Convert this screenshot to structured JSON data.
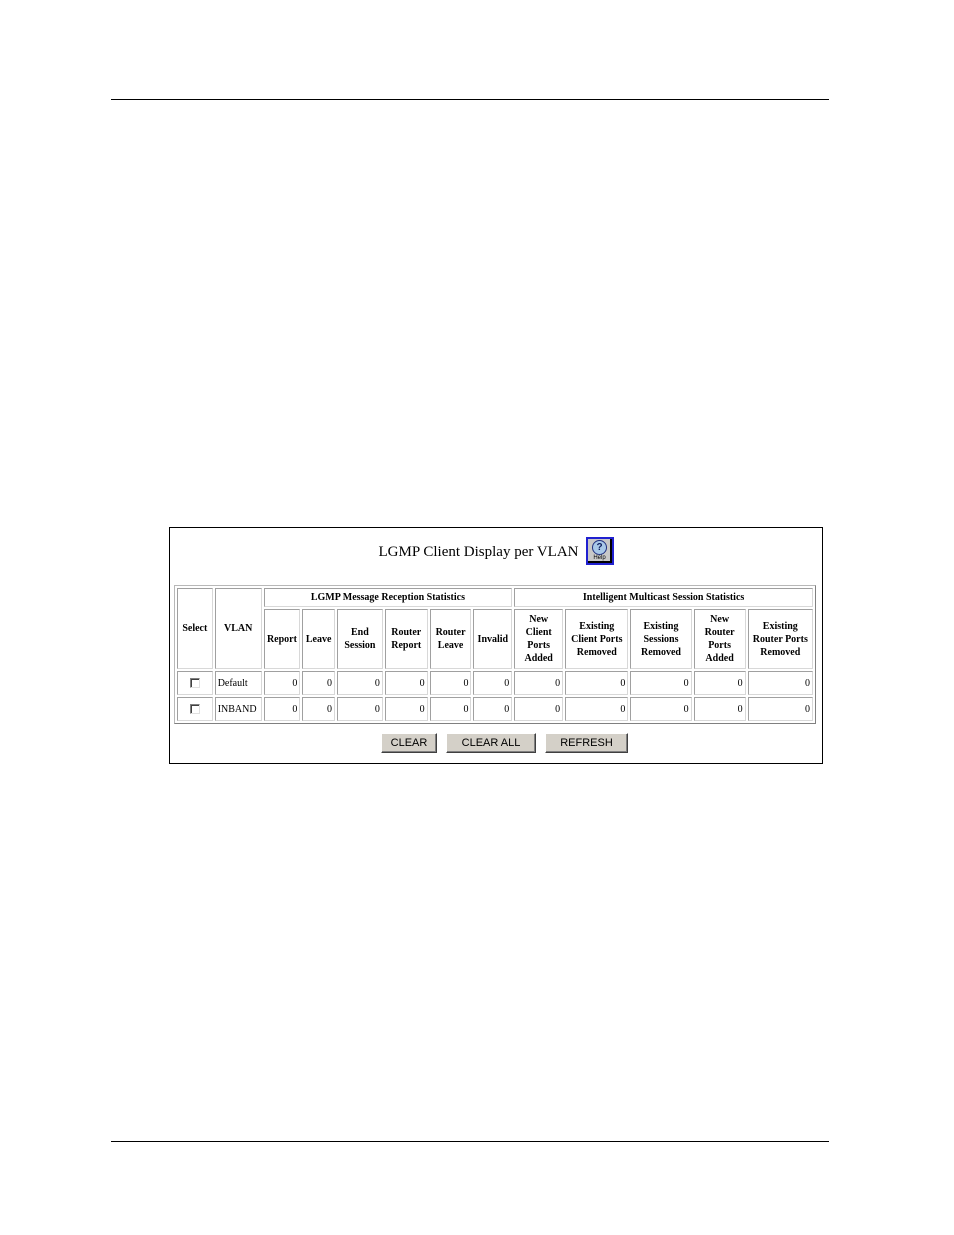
{
  "panel": {
    "title": "LGMP Client Display per VLAN",
    "help_icon_label": "Help",
    "help_icon_glyph": "?"
  },
  "table": {
    "headers": {
      "select": "Select",
      "vlan": "VLAN",
      "group_lgmp": "LGMP Message Reception Statistics",
      "group_ims": "Intelligent Multicast Session Statistics",
      "columns": [
        "Report",
        "Leave",
        "End Session",
        "Router Report",
        "Router Leave",
        "Invalid",
        "New Client Ports Added",
        "Existing Client Ports Removed",
        "Existing Sessions Removed",
        "New Router Ports Added",
        "Existing Router Ports Removed"
      ]
    },
    "rows": [
      {
        "selected": false,
        "vlan": "Default",
        "values": [
          "0",
          "0",
          "0",
          "0",
          "0",
          "0",
          "0",
          "0",
          "0",
          "0",
          "0"
        ]
      },
      {
        "selected": false,
        "vlan": "INBAND",
        "values": [
          "0",
          "0",
          "0",
          "0",
          "0",
          "0",
          "0",
          "0",
          "0",
          "0",
          "0"
        ]
      }
    ]
  },
  "buttons": {
    "clear": "CLEAR",
    "clear_all": "CLEAR ALL",
    "refresh": "REFRESH"
  }
}
